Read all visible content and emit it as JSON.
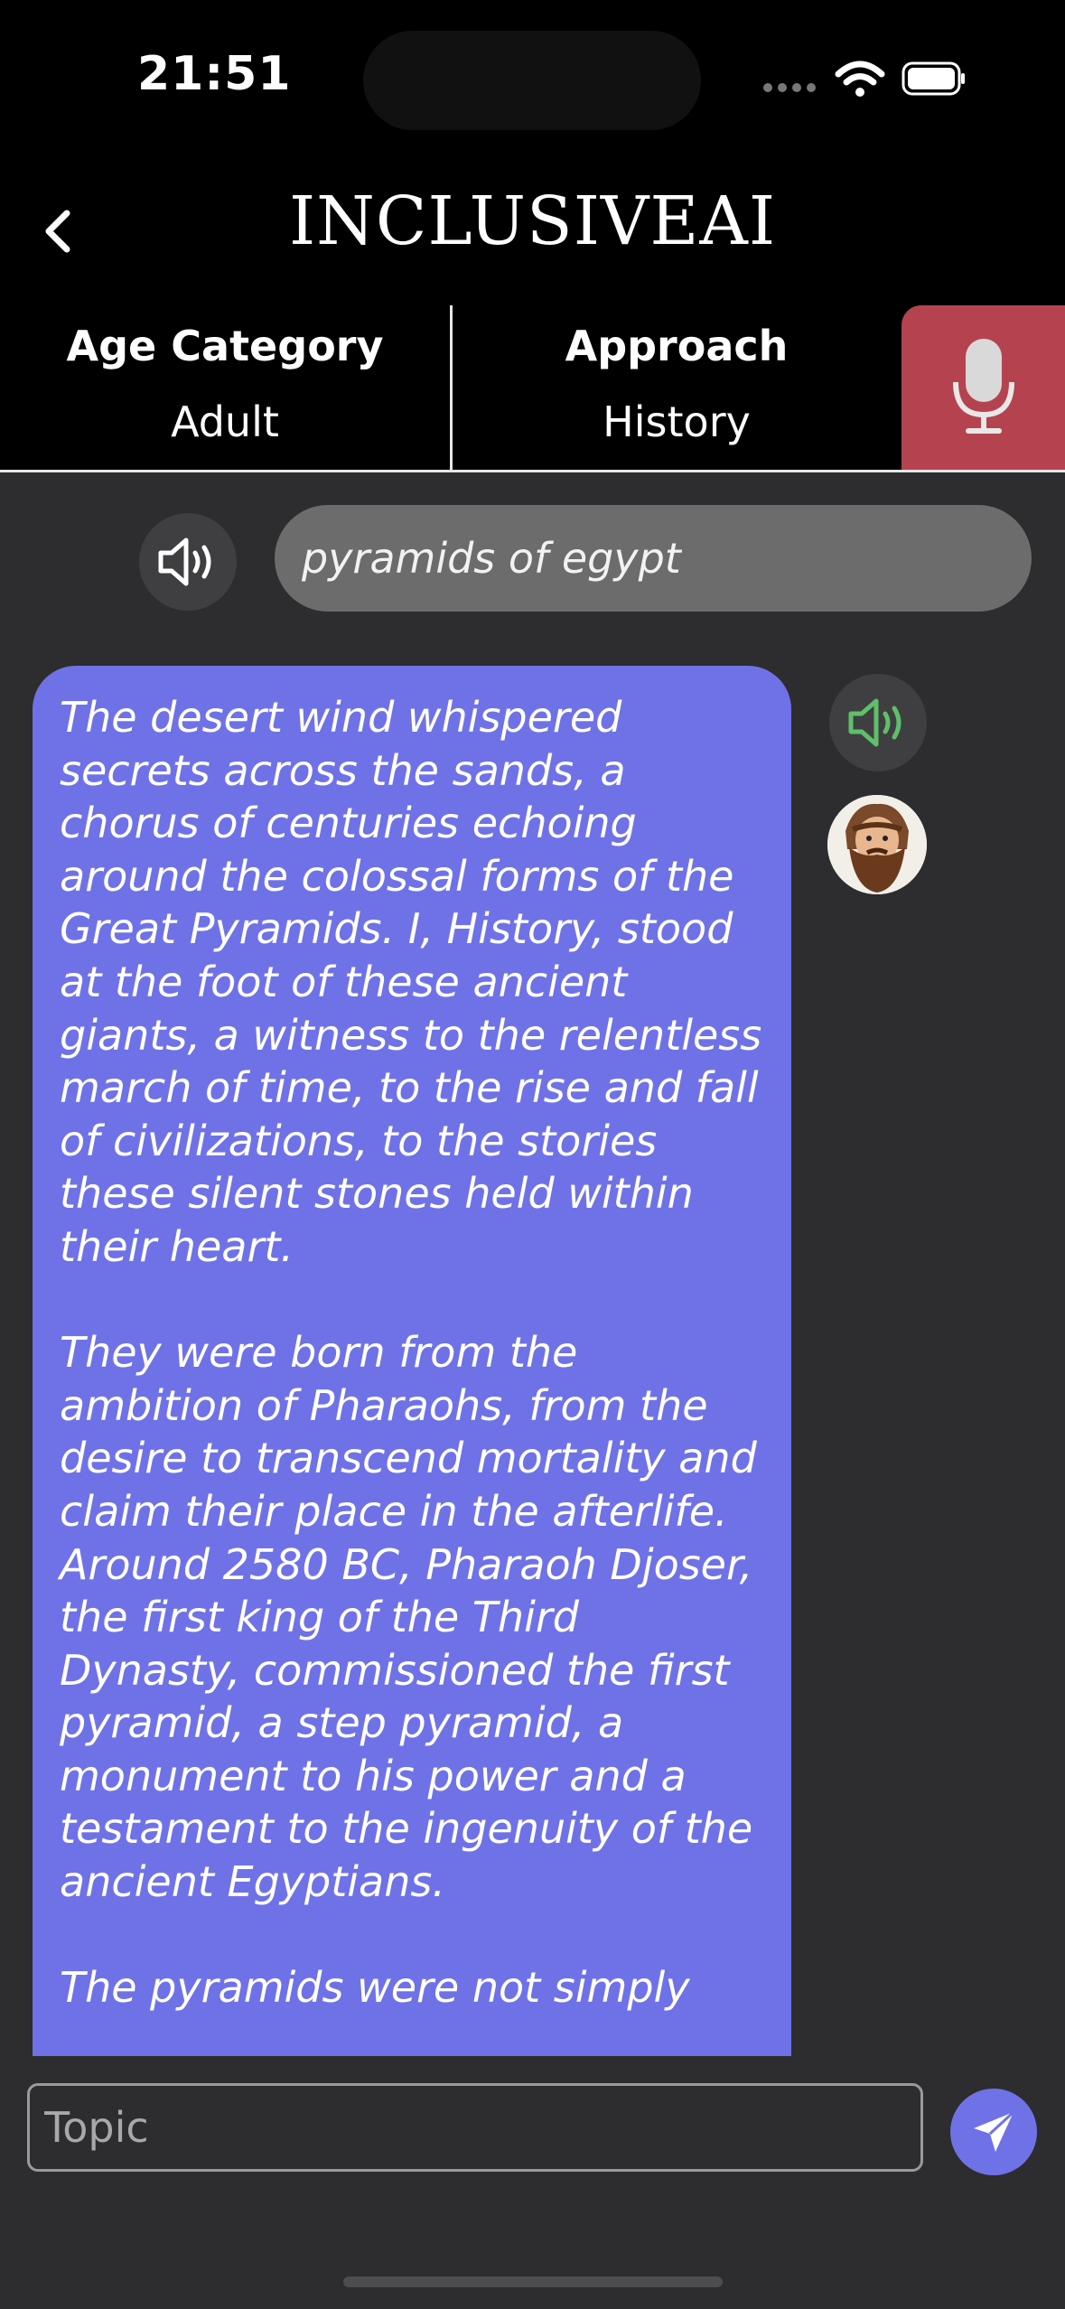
{
  "status_bar": {
    "time": "21:51"
  },
  "nav": {
    "title": "INCLUSIVEAI"
  },
  "settings": {
    "age_label": "Age Category",
    "age_value": "Adult",
    "approach_label": "Approach",
    "approach_value": "History"
  },
  "chat": {
    "user_message": "pyramids of egypt",
    "ai_paragraphs": [
      "The desert wind whispered secrets across the sands, a chorus of centuries echoing around the colossal forms of the Great Pyramids. I, History, stood at the foot of these ancient giants, a witness to the relentless march of time, to the rise and fall of civilizations, to the stories these silent stones held within their heart.",
      "They were born from the ambition of Pharaohs, from the desire to transcend mortality and claim their place in the afterlife.  Around 2580 BC, Pharaoh Djoser, the first king of the Third Dynasty, commissioned the first pyramid, a step pyramid, a monument to his power and a testament to the ingenuity of the ancient Egyptians.",
      "The pyramids were not simply"
    ]
  },
  "composer": {
    "placeholder": "Topic"
  },
  "colors": {
    "accent": "#6f72e6",
    "mic": "#b5434f",
    "speaker_active": "#5fbf6a"
  }
}
